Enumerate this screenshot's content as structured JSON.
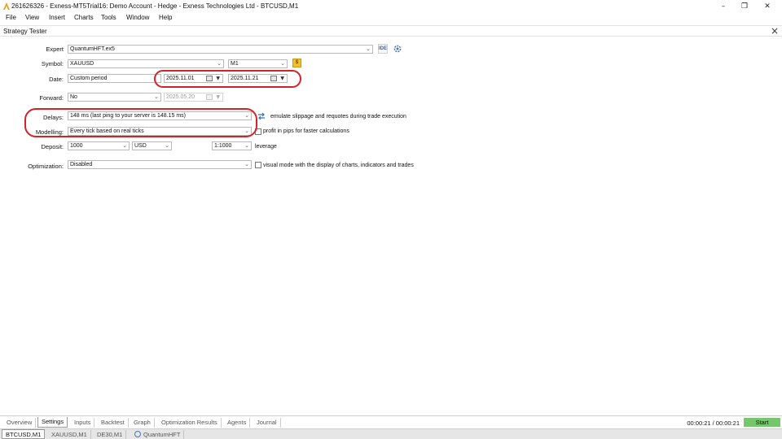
{
  "window": {
    "title": "261626326 - Exness-MT5Trial16: Demo Account - Hedge - Exness Technologies Ltd - BTCUSD,M1"
  },
  "menu": [
    "File",
    "View",
    "Insert",
    "Charts",
    "Tools",
    "Window",
    "Help"
  ],
  "panel": {
    "title": "Strategy Tester"
  },
  "form": {
    "expert": {
      "label": "Expert",
      "value": "QuantumHFT.ex5",
      "ide_label": "IDE"
    },
    "symbol": {
      "label": "Symbol:",
      "value": "XAUUSD",
      "timeframe": "M1",
      "badge": "$"
    },
    "date": {
      "label": "Date:",
      "period": "Custom period",
      "from": "2025.11.01",
      "to": "2025.11.21"
    },
    "forward": {
      "label": "Forward:",
      "value": "No",
      "date": "2025.05.20"
    },
    "delays": {
      "label": "Delays:",
      "value": "148 ms (last ping to your server is 148.15 ms)",
      "note": "emulate slippage and requotes during trade execution"
    },
    "modelling": {
      "label": "Modelling:",
      "value": "Every tick based on real ticks",
      "checkbox_label": "profit in pips for faster calculations",
      "checked": false
    },
    "deposit": {
      "label": "Deposit:",
      "amount": "1000",
      "currency": "USD",
      "leverage_value": "1:1000",
      "leverage_label": "leverage"
    },
    "optimization": {
      "label": "Optimization:",
      "value": "Disabled",
      "checkbox_label": "visual mode with the display of charts, indicators and trades",
      "checked": false
    }
  },
  "bottom_tabs": [
    "Overview",
    "Settings",
    "Inputs",
    "Backtest",
    "Graph",
    "Optimization Results",
    "Agents",
    "Journal"
  ],
  "active_tab": "Settings",
  "timer": "00:00:21 / 00:00:21",
  "start_label": "Start",
  "chart_tabs": [
    "BTCUSD,M1",
    "XAUUSD,M1",
    "DE30,M1",
    "QuantumHFT"
  ],
  "colors": {
    "annotation": "#d2232a",
    "start": "#76c66c",
    "settings_icon": "#4a79b5",
    "app_icon": "#e0a418"
  }
}
